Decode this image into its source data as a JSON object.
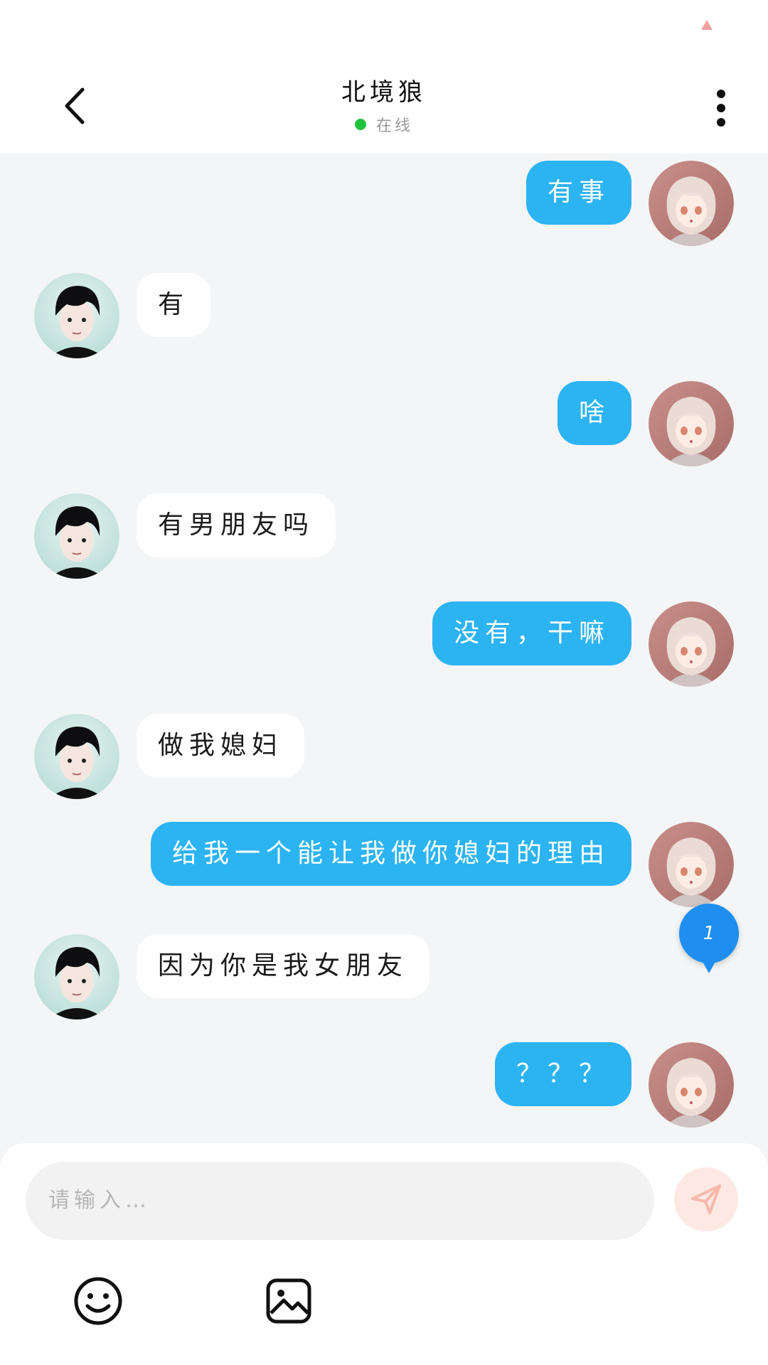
{
  "header": {
    "title": "北境狼",
    "status": "在线",
    "status_color": "#1fc23b"
  },
  "messages": [
    {
      "side": "out",
      "text": "有事",
      "avatar": "girl-avatar"
    },
    {
      "side": "in",
      "text": "有",
      "avatar": "boy-avatar"
    },
    {
      "side": "out",
      "text": "啥",
      "avatar": "girl-avatar"
    },
    {
      "side": "in",
      "text": "有男朋友吗",
      "avatar": "boy-avatar"
    },
    {
      "side": "out",
      "text": "没有，干嘛",
      "avatar": "girl-avatar"
    },
    {
      "side": "in",
      "text": "做我媳妇",
      "avatar": "boy-avatar"
    },
    {
      "side": "out",
      "text": "给我一个能让我做你媳妇的理由",
      "avatar": "girl-avatar"
    },
    {
      "side": "in",
      "text": "因为你是我女朋友",
      "avatar": "boy-avatar"
    },
    {
      "side": "out",
      "text": "？？？",
      "avatar": "girl-avatar"
    }
  ],
  "unread_badge": "1",
  "composer": {
    "placeholder": "请输入…"
  },
  "colors": {
    "outgoing_bubble": "#2cb3f2",
    "incoming_bubble": "#ffffff",
    "send_button": "#fde8e3"
  }
}
